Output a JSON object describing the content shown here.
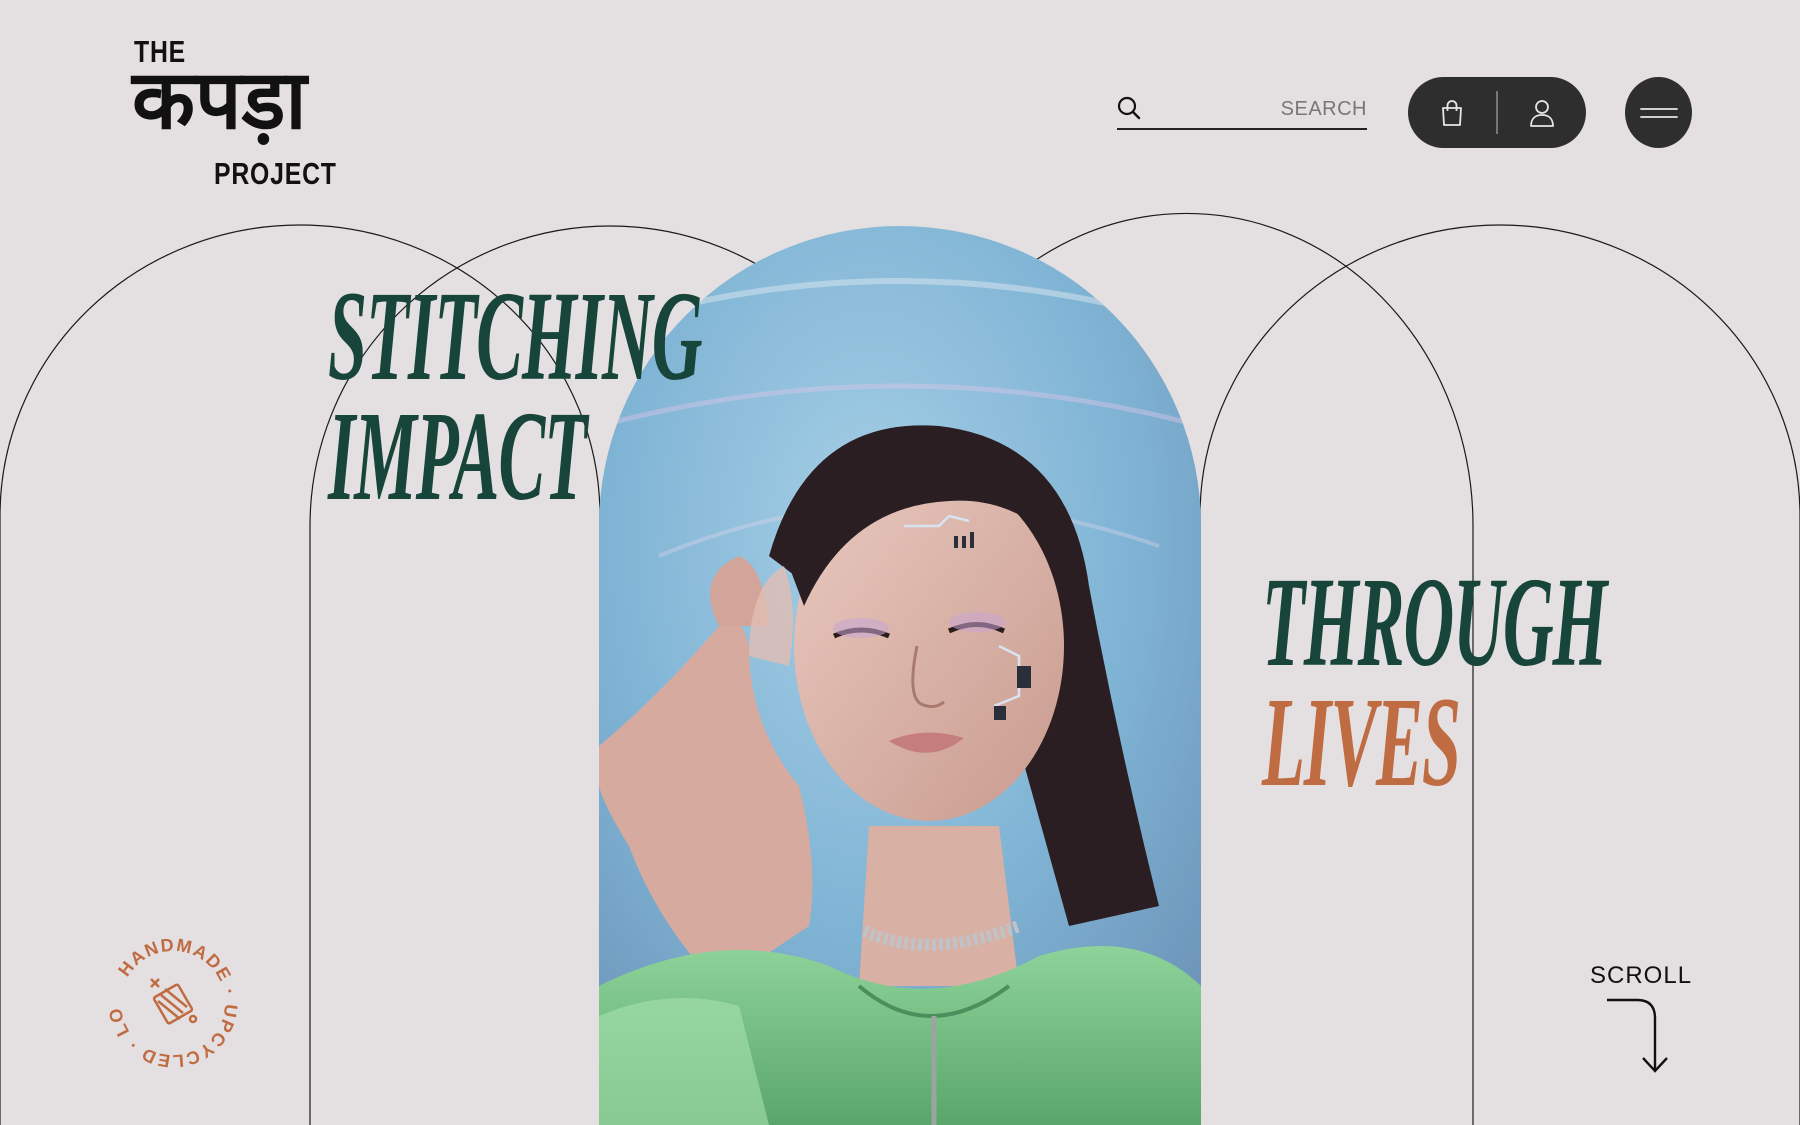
{
  "logo": {
    "top": "THE",
    "main": "कपड़ा",
    "bottom": "PROJECT"
  },
  "search": {
    "placeholder": "SEARCH",
    "icon": "search-icon"
  },
  "header_actions": {
    "cart_icon": "shopping-bag-icon",
    "user_icon": "user-icon",
    "menu_icon": "hamburger-menu-icon"
  },
  "hero": {
    "line1": "STITCHING",
    "line2": "IMPACT",
    "line3": "THROUGH",
    "line4": "LIVES"
  },
  "badge": {
    "text": "HANDMADE · UPCYCLED · LOCAL ·",
    "icon": "thread-spool-icon"
  },
  "scroll": {
    "label": "SCROLL",
    "icon": "arrow-down-curve-icon"
  },
  "colors": {
    "background": "#e4dfe0",
    "green": "#17453a",
    "copper": "#c06c43",
    "dark": "#2e2e2e"
  }
}
